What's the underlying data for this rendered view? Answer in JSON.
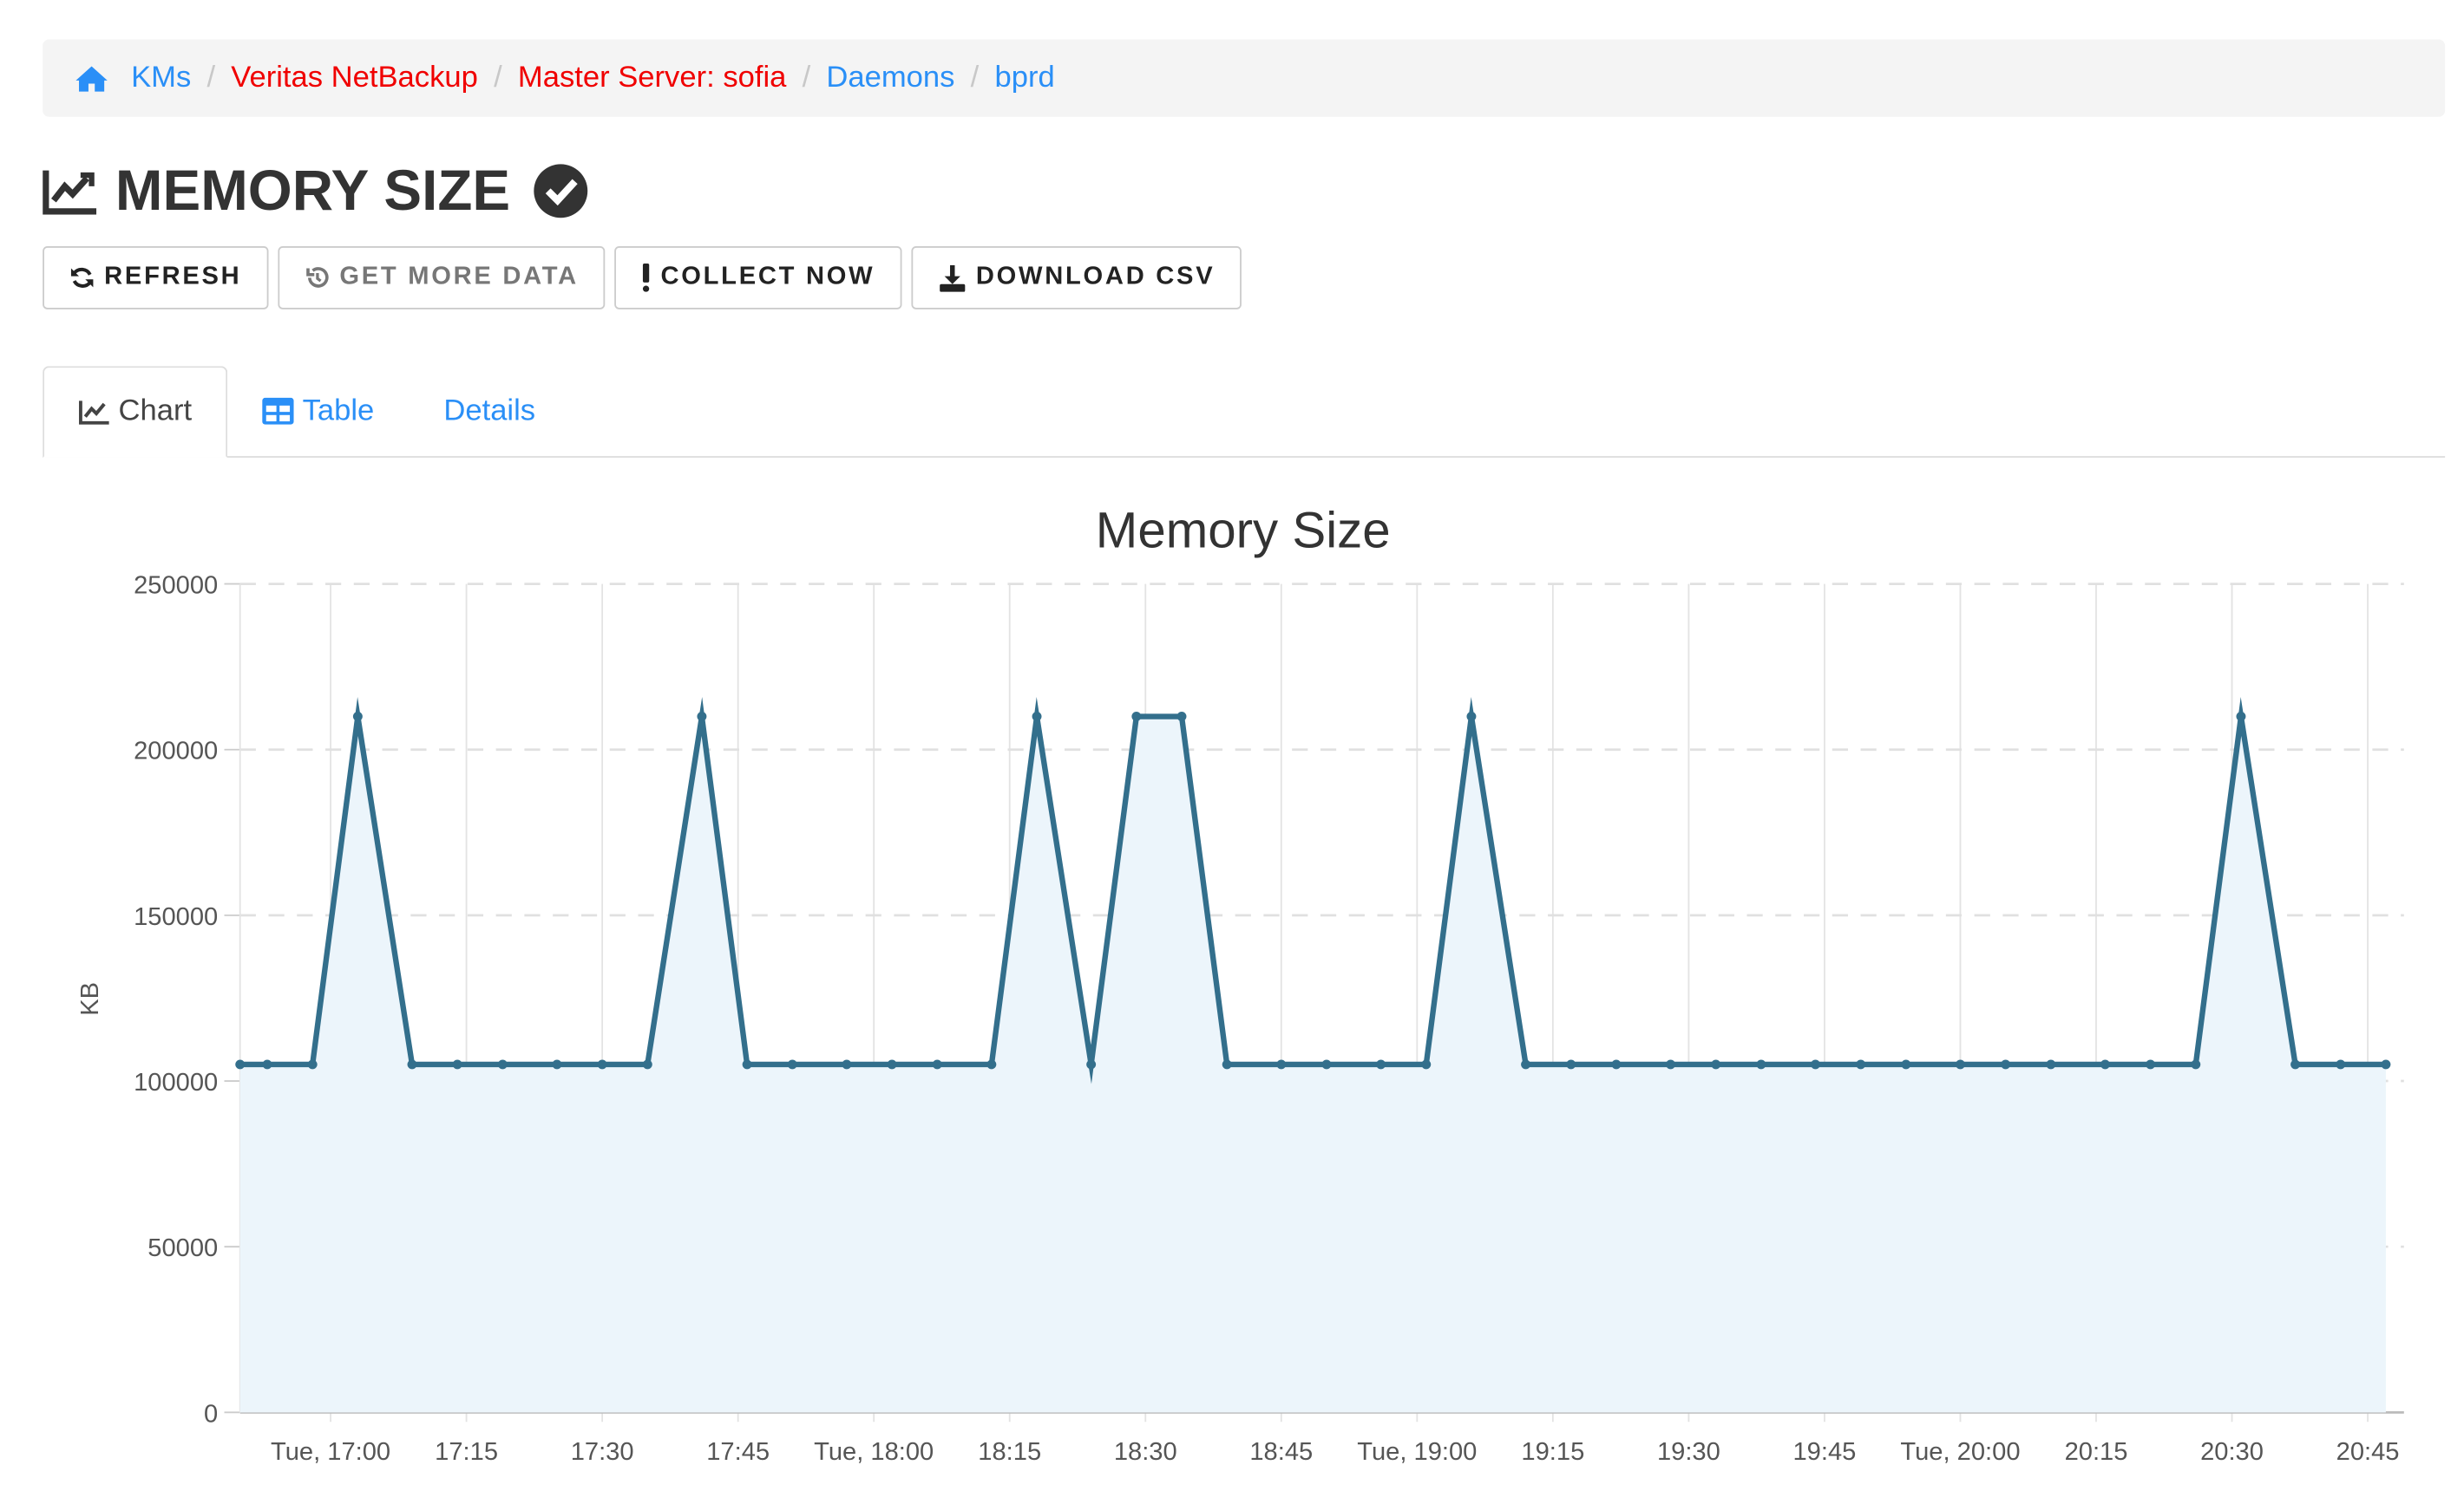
{
  "breadcrumb": [
    {
      "label": "KMs",
      "color": "#2a8ff7",
      "icon": "home-icon"
    },
    {
      "label": "Veritas NetBackup",
      "color": "#f00000"
    },
    {
      "label": "Master Server: sofia",
      "color": "#f00000"
    },
    {
      "label": "Daemons",
      "color": "#2a8ff7"
    },
    {
      "label": "bprd",
      "color": "#2a8ff7"
    }
  ],
  "header": {
    "title": "MEMORY SIZE",
    "icon": "line-chart-icon",
    "status_icon": "check-circle-icon"
  },
  "toolbar": {
    "refresh": "REFRESH",
    "get_more_data": "GET MORE DATA",
    "collect_now": "COLLECT NOW",
    "download_csv": "DOWNLOAD CSV"
  },
  "tabs": [
    {
      "label": "Chart",
      "active": true,
      "icon": "line-chart-icon"
    },
    {
      "label": "Table",
      "active": false,
      "icon": "table-icon"
    },
    {
      "label": "Details",
      "active": false
    }
  ],
  "chart_data": {
    "type": "area",
    "title": "Memory Size",
    "xlabel": "",
    "ylabel": "KB",
    "ylim": [
      0,
      250000
    ],
    "yticks": [
      "0",
      "50000",
      "100000",
      "150000",
      "200000",
      "250000"
    ],
    "xlim": [
      "16:50",
      "20:49"
    ],
    "xticks": [
      {
        "t": "17:00",
        "label": "Tue, 17:00"
      },
      {
        "t": "17:15",
        "label": "17:15"
      },
      {
        "t": "17:30",
        "label": "17:30"
      },
      {
        "t": "17:45",
        "label": "17:45"
      },
      {
        "t": "18:00",
        "label": "Tue, 18:00"
      },
      {
        "t": "18:15",
        "label": "18:15"
      },
      {
        "t": "18:30",
        "label": "18:30"
      },
      {
        "t": "18:45",
        "label": "18:45"
      },
      {
        "t": "19:00",
        "label": "Tue, 19:00"
      },
      {
        "t": "19:15",
        "label": "19:15"
      },
      {
        "t": "19:30",
        "label": "19:30"
      },
      {
        "t": "19:45",
        "label": "19:45"
      },
      {
        "t": "20:00",
        "label": "Tue, 20:00"
      },
      {
        "t": "20:15",
        "label": "20:15"
      },
      {
        "t": "20:30",
        "label": "20:30"
      },
      {
        "t": "20:45",
        "label": "20:45"
      }
    ],
    "grid": true,
    "line_color": "#336f8c",
    "fill_color": "#ecf5fb",
    "x": [
      "16:50",
      "16:53",
      "16:58",
      "17:03",
      "17:09",
      "17:14",
      "17:19",
      "17:25",
      "17:30",
      "17:35",
      "17:41",
      "17:46",
      "17:51",
      "17:57",
      "18:02",
      "18:07",
      "18:13",
      "18:18",
      "18:24",
      "18:29",
      "18:34",
      "18:39",
      "18:45",
      "18:50",
      "18:56",
      "19:01",
      "19:06",
      "19:12",
      "19:17",
      "19:22",
      "19:28",
      "19:33",
      "19:38",
      "19:44",
      "19:49",
      "19:54",
      "20:00",
      "20:05",
      "20:10",
      "20:16",
      "20:21",
      "20:26",
      "20:31",
      "20:37",
      "20:42",
      "20:47"
    ],
    "y": [
      105000,
      105000,
      105000,
      210000,
      105000,
      105000,
      105000,
      105000,
      105000,
      105000,
      210000,
      105000,
      105000,
      105000,
      105000,
      105000,
      105000,
      210000,
      105000,
      210000,
      210000,
      105000,
      105000,
      105000,
      105000,
      105000,
      210000,
      105000,
      105000,
      105000,
      105000,
      105000,
      105000,
      105000,
      105000,
      105000,
      105000,
      105000,
      105000,
      105000,
      105000,
      105000,
      210000,
      105000,
      105000,
      105000
    ]
  }
}
